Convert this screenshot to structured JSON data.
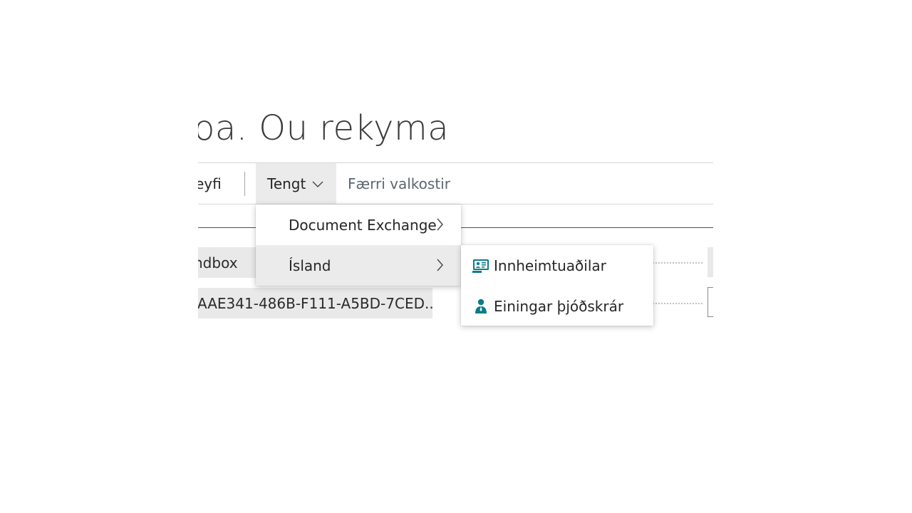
{
  "page": {
    "title_partial": "oa. Ou rekyma"
  },
  "actionbar": {
    "partial_action": "eyfi",
    "related_label": "Tengt",
    "fewer_options_label": "Færri valkostir"
  },
  "fields": {
    "field1_value": "ndbox",
    "field2_value": "AAE341-486B-F111-A5BD-7CED..."
  },
  "related_menu": {
    "items": [
      {
        "label": "Document Exchange",
        "icon": "chevron-right-icon"
      },
      {
        "label": "Ísland",
        "icon": "chevron-right-icon"
      }
    ]
  },
  "island_submenu": {
    "items": [
      {
        "label": "Innheimtuaðilar",
        "icon": "contact-card-icon"
      },
      {
        "label": "Einingar þjóðskrár",
        "icon": "person-icon"
      }
    ]
  },
  "colors": {
    "accent_teal": "#0f7b8a",
    "hover_gray": "#ebebeb"
  }
}
